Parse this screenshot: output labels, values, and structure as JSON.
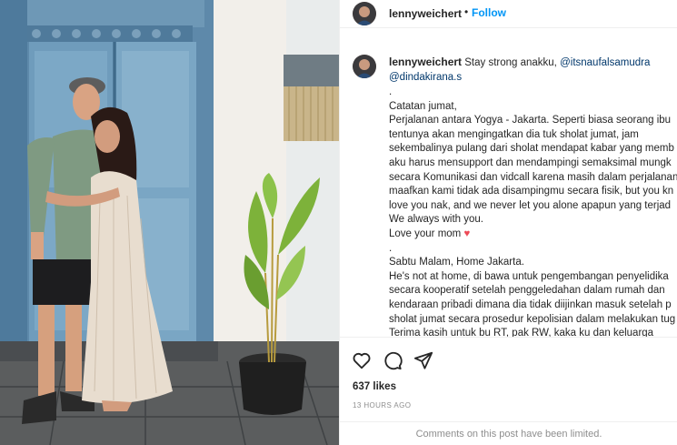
{
  "post": {
    "username": "lennyweichert",
    "separator": "•",
    "follow_label": "Follow"
  },
  "caption": {
    "username": "lennyweichert",
    "intro": "Stay strong anakku,",
    "mention1": "@itsnaufalsamudra",
    "mention2": "@dindakirana.s",
    "body": ".\nCatatan jumat,\nPerjalanan antara Yogya - Jakarta. Seperti biasa seorang ibu\ntentunya akan mengingatkan dia tuk sholat jumat, jam\nsekembalinya pulang dari sholat mendapat kabar yang memb\naku harus mensupport dan mendampingi semaksimal mungk\nsecara Komunikasi dan vidcall karena masih dalam perjalanan\nmaafkan kami tidak ada disampingmu secara fisik, but you kn\nlove you nak, and we never let you alone apapun yang terjad\nWe always with you.\nLove your mom",
    "heart": "♥",
    "body2": ".\nSabtu Malam, Home Jakarta.\nHe's not at home, di bawa untuk pengembangan penyelidika\nsecara kooperatif setelah penggeledahan dalam rumah dan\nkendaraan pribadi dimana dia tidak diijinkan masuk setelah p\nsholat jumat secara prosedur kepolisian dalam melakukan tug\nTerima kasih untuk bu RT, pak RW, kaka ku dan keluarga"
  },
  "actions": {
    "like_icon": "heart-outline-icon",
    "comment_icon": "comment-bubble-icon",
    "share_icon": "paper-plane-icon",
    "likes": "637 likes",
    "timestamp": "13 HOURS AGO",
    "limited_notice": "Comments on this post have been limited."
  },
  "colors": {
    "link_blue": "#0095f6",
    "mention": "#00376b",
    "heart_red": "#ed4956",
    "muted": "#8e8e8e"
  }
}
